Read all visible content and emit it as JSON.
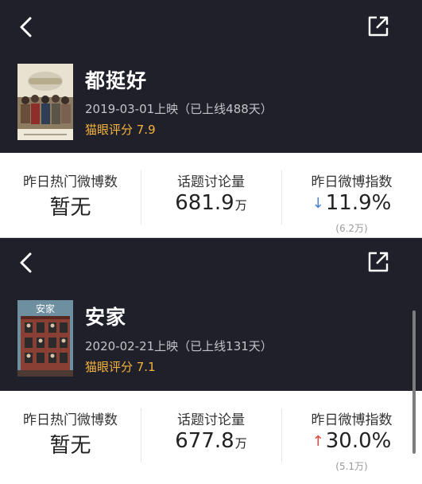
{
  "cards": [
    {
      "title": "都挺好",
      "release": "2019-03-01上映（已上线488天）",
      "rating": "猫眼评分 7.9",
      "stats": {
        "hot_label": "昨日热门微博数",
        "hot_value": "暂无",
        "topic_label": "话题讨论量",
        "topic_value": "681.9",
        "topic_unit": "万",
        "index_label": "昨日微博指数",
        "index_arrow": "↓",
        "index_value": "11.9%",
        "index_sub": "(6.2万)"
      }
    },
    {
      "title": "安家",
      "release": "2020-02-21上映（已上线131天）",
      "rating": "猫眼评分 7.1",
      "poster_text": "安家",
      "stats": {
        "hot_label": "昨日热门微博数",
        "hot_value": "暂无",
        "topic_label": "话题讨论量",
        "topic_value": "677.8",
        "topic_unit": "万",
        "index_label": "昨日微博指数",
        "index_arrow": "↑",
        "index_value": "30.0%",
        "index_sub": "(5.1万)"
      }
    }
  ],
  "colors": {
    "header_bg": "#20202b",
    "rating": "#f5b33c",
    "down_arrow": "#4a7fd4",
    "up_arrow": "#e3443b"
  },
  "icons": {
    "back": "chevron-left-icon",
    "share": "share-external-icon"
  }
}
